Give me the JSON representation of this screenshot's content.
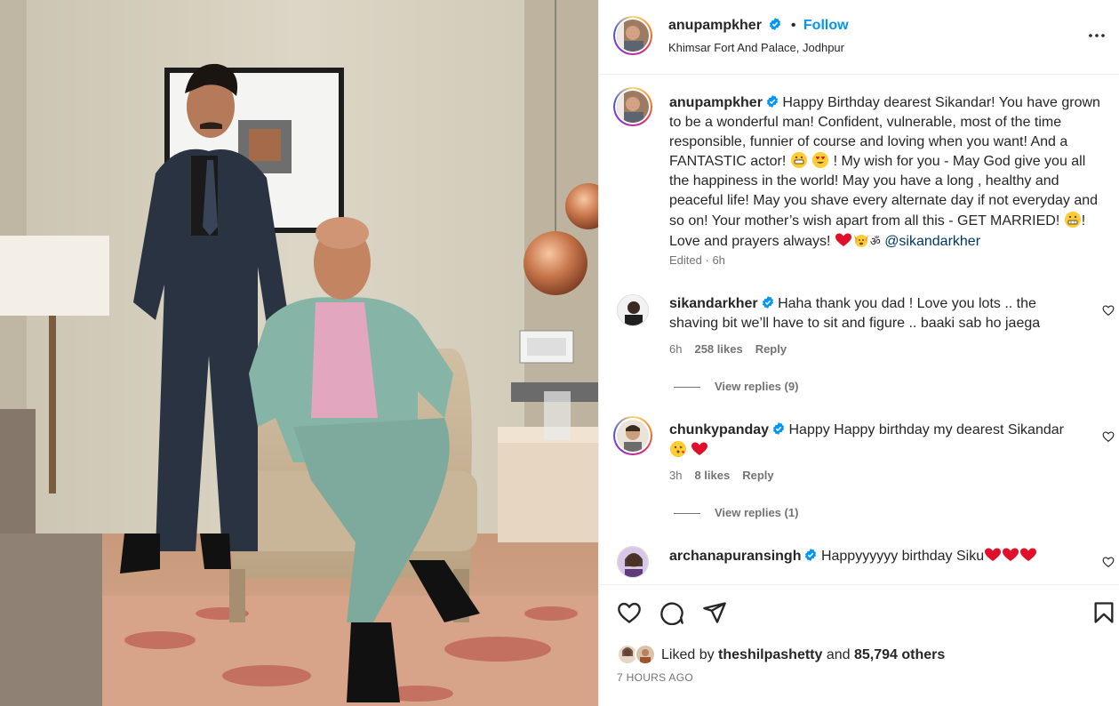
{
  "post": {
    "author": "anupampkher",
    "follow_label": "Follow",
    "separator": "•",
    "location": "Khimsar Fort And Palace, Jodhpur",
    "more_icon": "more-horizontal-icon"
  },
  "caption": {
    "username": "anupampkher",
    "text_1": "Happy Birthday dearest Sikandar! You have grown to be a wonderful man! Confident, vulnerable, most of the time responsible, funnier of course and loving when you want! And a FANTASTIC actor! ",
    "text_2": " ! My wish for you - May God give you all the happiness in the world! May you have a long , healthy and peaceful life! May you shave every alternate day if not everyday and so on! Your mother’s wish apart from all this - GET MARRIED! ",
    "text_3": "! Love and prayers always! ",
    "om_symbol": "ॐ",
    "mention": "@sikandarkher",
    "edited": "Edited",
    "meta_sep": " · ",
    "time": "6h"
  },
  "comments": [
    {
      "username": "sikandarkher",
      "text": "Haha thank you dad ! Love you lots .. the shaving bit we’ll have to sit and figure .. baaki sab ho jaega",
      "time": "6h",
      "likes": "258 likes",
      "reply": "Reply",
      "view_replies": "View replies (9)"
    },
    {
      "username": "chunkypanday",
      "text": "Happy Happy birthday my dearest Sikandar",
      "time": "3h",
      "likes": "8 likes",
      "reply": "Reply",
      "view_replies": "View replies (1)"
    },
    {
      "username": "archanapuransingh",
      "text": "Happyyyyyy birthday Siku"
    }
  ],
  "footer": {
    "liked_by_prefix": "Liked by ",
    "liked_by_user": "theshilpashetty",
    "and": " and ",
    "others": "85,794 others",
    "timestamp": "7 HOURS AGO"
  },
  "colors": {
    "link_blue": "#0095f6",
    "verified_blue": "#0095f6",
    "heart_red": "#e0102b",
    "text": "#262626",
    "muted": "#737373"
  }
}
